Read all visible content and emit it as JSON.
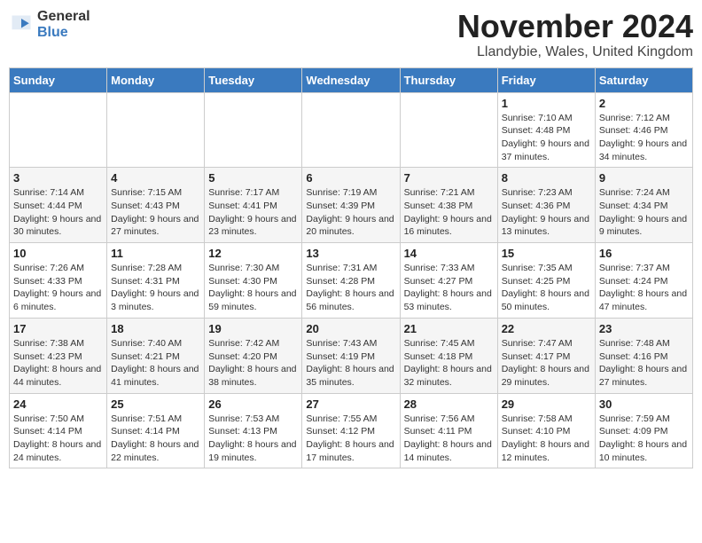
{
  "logo": {
    "general": "General",
    "blue": "Blue"
  },
  "title": "November 2024",
  "location": "Llandybie, Wales, United Kingdom",
  "days_of_week": [
    "Sunday",
    "Monday",
    "Tuesday",
    "Wednesday",
    "Thursday",
    "Friday",
    "Saturday"
  ],
  "weeks": [
    [
      {
        "day": "",
        "info": ""
      },
      {
        "day": "",
        "info": ""
      },
      {
        "day": "",
        "info": ""
      },
      {
        "day": "",
        "info": ""
      },
      {
        "day": "",
        "info": ""
      },
      {
        "day": "1",
        "info": "Sunrise: 7:10 AM\nSunset: 4:48 PM\nDaylight: 9 hours and 37 minutes."
      },
      {
        "day": "2",
        "info": "Sunrise: 7:12 AM\nSunset: 4:46 PM\nDaylight: 9 hours and 34 minutes."
      }
    ],
    [
      {
        "day": "3",
        "info": "Sunrise: 7:14 AM\nSunset: 4:44 PM\nDaylight: 9 hours and 30 minutes."
      },
      {
        "day": "4",
        "info": "Sunrise: 7:15 AM\nSunset: 4:43 PM\nDaylight: 9 hours and 27 minutes."
      },
      {
        "day": "5",
        "info": "Sunrise: 7:17 AM\nSunset: 4:41 PM\nDaylight: 9 hours and 23 minutes."
      },
      {
        "day": "6",
        "info": "Sunrise: 7:19 AM\nSunset: 4:39 PM\nDaylight: 9 hours and 20 minutes."
      },
      {
        "day": "7",
        "info": "Sunrise: 7:21 AM\nSunset: 4:38 PM\nDaylight: 9 hours and 16 minutes."
      },
      {
        "day": "8",
        "info": "Sunrise: 7:23 AM\nSunset: 4:36 PM\nDaylight: 9 hours and 13 minutes."
      },
      {
        "day": "9",
        "info": "Sunrise: 7:24 AM\nSunset: 4:34 PM\nDaylight: 9 hours and 9 minutes."
      }
    ],
    [
      {
        "day": "10",
        "info": "Sunrise: 7:26 AM\nSunset: 4:33 PM\nDaylight: 9 hours and 6 minutes."
      },
      {
        "day": "11",
        "info": "Sunrise: 7:28 AM\nSunset: 4:31 PM\nDaylight: 9 hours and 3 minutes."
      },
      {
        "day": "12",
        "info": "Sunrise: 7:30 AM\nSunset: 4:30 PM\nDaylight: 8 hours and 59 minutes."
      },
      {
        "day": "13",
        "info": "Sunrise: 7:31 AM\nSunset: 4:28 PM\nDaylight: 8 hours and 56 minutes."
      },
      {
        "day": "14",
        "info": "Sunrise: 7:33 AM\nSunset: 4:27 PM\nDaylight: 8 hours and 53 minutes."
      },
      {
        "day": "15",
        "info": "Sunrise: 7:35 AM\nSunset: 4:25 PM\nDaylight: 8 hours and 50 minutes."
      },
      {
        "day": "16",
        "info": "Sunrise: 7:37 AM\nSunset: 4:24 PM\nDaylight: 8 hours and 47 minutes."
      }
    ],
    [
      {
        "day": "17",
        "info": "Sunrise: 7:38 AM\nSunset: 4:23 PM\nDaylight: 8 hours and 44 minutes."
      },
      {
        "day": "18",
        "info": "Sunrise: 7:40 AM\nSunset: 4:21 PM\nDaylight: 8 hours and 41 minutes."
      },
      {
        "day": "19",
        "info": "Sunrise: 7:42 AM\nSunset: 4:20 PM\nDaylight: 8 hours and 38 minutes."
      },
      {
        "day": "20",
        "info": "Sunrise: 7:43 AM\nSunset: 4:19 PM\nDaylight: 8 hours and 35 minutes."
      },
      {
        "day": "21",
        "info": "Sunrise: 7:45 AM\nSunset: 4:18 PM\nDaylight: 8 hours and 32 minutes."
      },
      {
        "day": "22",
        "info": "Sunrise: 7:47 AM\nSunset: 4:17 PM\nDaylight: 8 hours and 29 minutes."
      },
      {
        "day": "23",
        "info": "Sunrise: 7:48 AM\nSunset: 4:16 PM\nDaylight: 8 hours and 27 minutes."
      }
    ],
    [
      {
        "day": "24",
        "info": "Sunrise: 7:50 AM\nSunset: 4:14 PM\nDaylight: 8 hours and 24 minutes."
      },
      {
        "day": "25",
        "info": "Sunrise: 7:51 AM\nSunset: 4:14 PM\nDaylight: 8 hours and 22 minutes."
      },
      {
        "day": "26",
        "info": "Sunrise: 7:53 AM\nSunset: 4:13 PM\nDaylight: 8 hours and 19 minutes."
      },
      {
        "day": "27",
        "info": "Sunrise: 7:55 AM\nSunset: 4:12 PM\nDaylight: 8 hours and 17 minutes."
      },
      {
        "day": "28",
        "info": "Sunrise: 7:56 AM\nSunset: 4:11 PM\nDaylight: 8 hours and 14 minutes."
      },
      {
        "day": "29",
        "info": "Sunrise: 7:58 AM\nSunset: 4:10 PM\nDaylight: 8 hours and 12 minutes."
      },
      {
        "day": "30",
        "info": "Sunrise: 7:59 AM\nSunset: 4:09 PM\nDaylight: 8 hours and 10 minutes."
      }
    ]
  ]
}
